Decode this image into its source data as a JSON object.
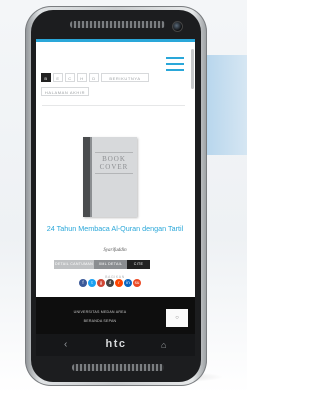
{
  "page": {
    "filters": [
      {
        "label": "B",
        "active": true
      },
      {
        "label": "E",
        "active": false
      },
      {
        "label": "C",
        "active": false
      },
      {
        "label": "H",
        "active": false
      },
      {
        "label": "D",
        "active": false
      },
      {
        "label": "BERIKUTNYA",
        "active": false
      },
      {
        "label": "HALAMAN AKHIR",
        "active": false
      }
    ],
    "book": {
      "cover_text": [
        "BOOK",
        "COVER"
      ],
      "title": "24 Tahun Membaca Al-Quran dengan Tartil",
      "author": "Syarifuddin"
    },
    "actions": {
      "detail_catalog": "DETAIL CANTUMAN",
      "xml_detail": "XML DETAIL",
      "cite": "CITE"
    },
    "share_label": "BAGIKAN",
    "social": [
      {
        "name": "facebook-icon",
        "glyph": "f",
        "color": "#3b5998"
      },
      {
        "name": "twitter-icon",
        "glyph": "t",
        "color": "#1da1f2"
      },
      {
        "name": "google-plus-icon",
        "glyph": "g",
        "color": "#d14836"
      },
      {
        "name": "digg-icon",
        "glyph": "d",
        "color": "#444444"
      },
      {
        "name": "reddit-icon",
        "glyph": "r",
        "color": "#ff4500"
      },
      {
        "name": "linkedin-icon",
        "glyph": "in",
        "color": "#0a66c2"
      },
      {
        "name": "stumbleupon-icon",
        "glyph": "su",
        "color": "#eb4924"
      }
    ],
    "footer": {
      "line1": "UNIVERSITAS MEDAN AREA",
      "line2": "BERANDA SEPAN",
      "search_icon": "search-icon"
    }
  },
  "device": {
    "brand": "htc",
    "back_icon": "back-icon",
    "home_icon": "home-icon"
  },
  "colors": {
    "accent": "#2aa7d9",
    "action_1": "#bfc1c3",
    "action_2": "#8b8e91",
    "action_3": "#222222",
    "footer": "#0e0e0e"
  }
}
